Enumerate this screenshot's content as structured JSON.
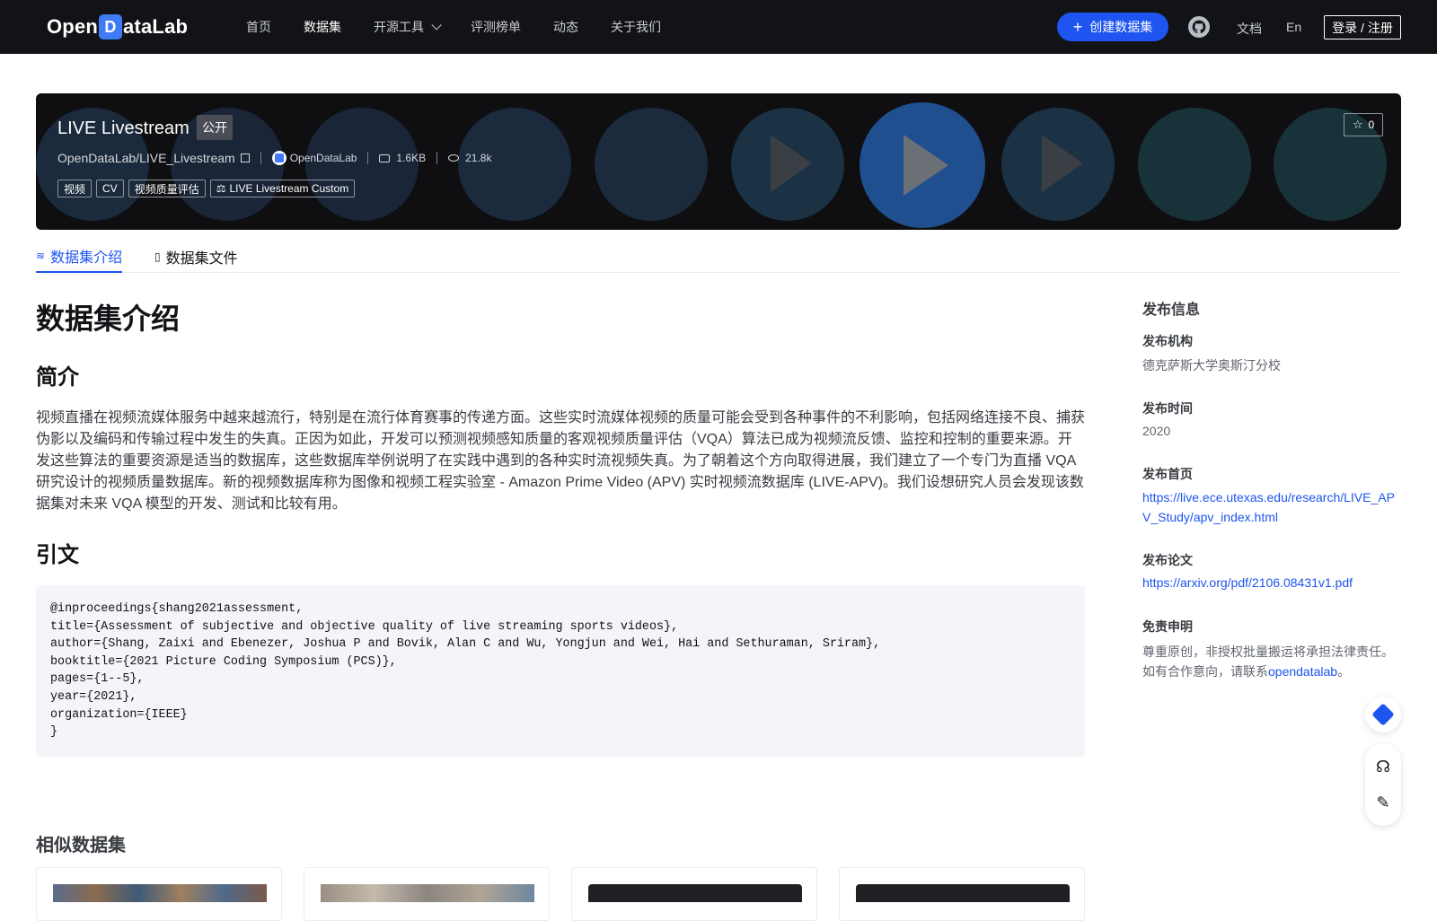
{
  "nav": {
    "logo_text_left": "Open",
    "logo_mark": "D",
    "logo_text_right": "ataLab",
    "items": [
      {
        "label": "首页"
      },
      {
        "label": "数据集"
      },
      {
        "label": "开源工具"
      },
      {
        "label": "评测榜单"
      },
      {
        "label": "动态"
      },
      {
        "label": "关于我们"
      }
    ],
    "active": "数据集",
    "create_label": "创建数据集",
    "docs_label": "文档",
    "lang_label": "En",
    "login_label": "登录 / 注册"
  },
  "hero": {
    "title": "LIVE Livestream",
    "visibility": "公开",
    "repo_path": "OpenDataLab/LIVE_Livestream",
    "org": "OpenDataLab",
    "size": "1.6KB",
    "views": "21.8k",
    "tags": [
      "视频",
      "CV",
      "视频质量评估",
      "LIVE Livestream Custom"
    ],
    "license_icon": "scale-icon",
    "stars": "0"
  },
  "tabs": [
    {
      "label": "数据集介绍",
      "icon": "database-icon"
    },
    {
      "label": "数据集文件",
      "icon": "file-icon"
    }
  ],
  "main": {
    "title": "数据集介绍",
    "intro_heading": "简介",
    "intro_text": "视频直播在视频流媒体服务中越来越流行，特别是在流行体育赛事的传递方面。这些实时流媒体视频的质量可能会受到各种事件的不利影响，包括网络连接不良、捕获伪影以及编码和传输过程中发生的失真。正因为如此，开发可以预测视频感知质量的客观视频质量评估（VQA）算法已成为视频流反馈、监控和控制的重要来源。开发这些算法的重要资源是适当的数据库，这些数据库举例说明了在实践中遇到的各种实时流视频失真。为了朝着这个方向取得进展，我们建立了一个专门为直播 VQA 研究设计的视频质量数据库。新的视频数据库称为图像和视频工程实验室 - Amazon Prime Video (APV) 实时视频流数据库 (LIVE-APV)。我们设想研究人员会发现该数据集对未来 VQA 模型的开发、测试和比较有用。",
    "citation_heading": "引文",
    "citation": "@inproceedings{shang2021assessment,\ntitle={Assessment of subjective and objective quality of live streaming sports videos},\nauthor={Shang, Zaixi and Ebenezer, Joshua P and Bovik, Alan C and Wu, Yongjun and Wei, Hai and Sethuraman, Sriram},\nbooktitle={2021 Picture Coding Symposium (PCS)},\npages={1--5},\nyear={2021},\norganization={IEEE}\n}"
  },
  "side": {
    "title": "发布信息",
    "org_label": "发布机构",
    "org_value": "德克萨斯大学奥斯汀分校",
    "time_label": "发布时间",
    "time_value": "2020",
    "home_label": "发布首页",
    "home_value": "https://live.ece.utexas.edu/research/LIVE_APV_Study/apv_index.html",
    "paper_label": "发布论文",
    "paper_value": "https://arxiv.org/pdf/2106.08431v1.pdf",
    "disclaimer_label": "免责申明",
    "disclaimer_text": "尊重原创，非授权批量搬运将承担法律责任。如有合作意向，请联系",
    "disclaimer_link": "opendatalab",
    "disclaimer_end": "。"
  },
  "similar": {
    "title": "相似数据集"
  },
  "colors": {
    "accent": "#1e54f0",
    "nav_bg": "#121316",
    "hero_bg": "#0f0f12"
  }
}
